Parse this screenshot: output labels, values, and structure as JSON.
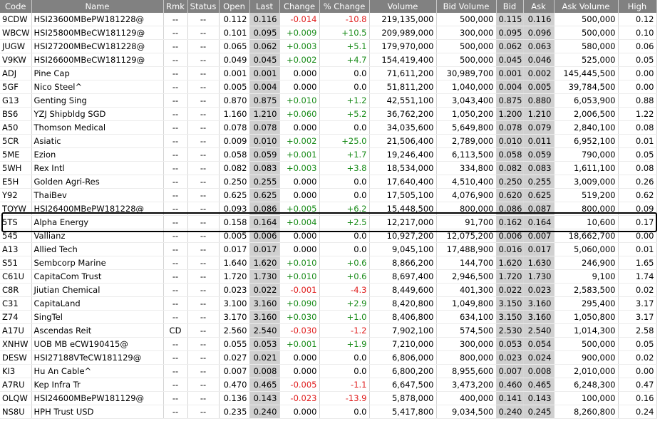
{
  "columns": [
    "Code",
    "Name",
    "Rmk",
    "Status",
    "Open",
    "Last",
    "Change",
    "% Change",
    "Volume",
    "Bid Volume",
    "Bid",
    "Ask",
    "Ask Volume",
    "High"
  ],
  "rows": [
    {
      "code": "9CDW",
      "name": "HSI23600MBePW181228@",
      "rmk": "--",
      "status": "--",
      "open": "0.112",
      "last": "0.116",
      "change": "-0.014",
      "pct": "-10.8",
      "volume": "219,135,000",
      "bid_volume": "500,000",
      "bid": "0.115",
      "ask": "0.116",
      "ask_volume": "500,000",
      "high": "0.12",
      "dir": "down"
    },
    {
      "code": "WBCW",
      "name": "HSI25800MBeCW181129@",
      "rmk": "--",
      "status": "--",
      "open": "0.101",
      "last": "0.095",
      "change": "+0.009",
      "pct": "+10.5",
      "volume": "209,989,000",
      "bid_volume": "300,000",
      "bid": "0.095",
      "ask": "0.096",
      "ask_volume": "500,000",
      "high": "0.10",
      "dir": "up"
    },
    {
      "code": "JUGW",
      "name": "HSI27200MBeCW181228@",
      "rmk": "--",
      "status": "--",
      "open": "0.065",
      "last": "0.062",
      "change": "+0.003",
      "pct": "+5.1",
      "volume": "179,970,000",
      "bid_volume": "500,000",
      "bid": "0.062",
      "ask": "0.063",
      "ask_volume": "580,000",
      "high": "0.06",
      "dir": "up"
    },
    {
      "code": "V9KW",
      "name": "HSI26600MBeCW181129@",
      "rmk": "--",
      "status": "--",
      "open": "0.049",
      "last": "0.045",
      "change": "+0.002",
      "pct": "+4.7",
      "volume": "154,419,400",
      "bid_volume": "500,000",
      "bid": "0.045",
      "ask": "0.046",
      "ask_volume": "525,000",
      "high": "0.05",
      "dir": "up"
    },
    {
      "code": "ADJ",
      "name": "Pine Cap",
      "rmk": "--",
      "status": "--",
      "open": "0.001",
      "last": "0.001",
      "change": "0.000",
      "pct": "0.0",
      "volume": "71,611,200",
      "bid_volume": "30,989,700",
      "bid": "0.001",
      "ask": "0.002",
      "ask_volume": "145,445,500",
      "high": "0.00",
      "dir": "flat"
    },
    {
      "code": "5GF",
      "name": "Nico Steel^",
      "rmk": "--",
      "status": "--",
      "open": "0.005",
      "last": "0.004",
      "change": "0.000",
      "pct": "0.0",
      "volume": "51,811,200",
      "bid_volume": "1,040,000",
      "bid": "0.004",
      "ask": "0.005",
      "ask_volume": "39,784,500",
      "high": "0.00",
      "dir": "flat"
    },
    {
      "code": "G13",
      "name": "Genting Sing",
      "rmk": "--",
      "status": "--",
      "open": "0.870",
      "last": "0.875",
      "change": "+0.010",
      "pct": "+1.2",
      "volume": "42,551,100",
      "bid_volume": "3,043,400",
      "bid": "0.875",
      "ask": "0.880",
      "ask_volume": "6,053,900",
      "high": "0.88",
      "dir": "up"
    },
    {
      "code": "BS6",
      "name": "YZJ Shipbldg SGD",
      "rmk": "--",
      "status": "--",
      "open": "1.160",
      "last": "1.210",
      "change": "+0.060",
      "pct": "+5.2",
      "volume": "36,762,200",
      "bid_volume": "1,050,200",
      "bid": "1.200",
      "ask": "1.210",
      "ask_volume": "2,006,500",
      "high": "1.22",
      "dir": "up"
    },
    {
      "code": "A50",
      "name": "Thomson Medical",
      "rmk": "--",
      "status": "--",
      "open": "0.078",
      "last": "0.078",
      "change": "0.000",
      "pct": "0.0",
      "volume": "34,035,600",
      "bid_volume": "5,649,800",
      "bid": "0.078",
      "ask": "0.079",
      "ask_volume": "2,840,100",
      "high": "0.08",
      "dir": "flat"
    },
    {
      "code": "5CR",
      "name": "Asiatic",
      "rmk": "--",
      "status": "--",
      "open": "0.009",
      "last": "0.010",
      "change": "+0.002",
      "pct": "+25.0",
      "volume": "21,506,400",
      "bid_volume": "2,789,000",
      "bid": "0.010",
      "ask": "0.011",
      "ask_volume": "6,952,100",
      "high": "0.01",
      "dir": "up"
    },
    {
      "code": "5ME",
      "name": "Ezion",
      "rmk": "--",
      "status": "--",
      "open": "0.058",
      "last": "0.059",
      "change": "+0.001",
      "pct": "+1.7",
      "volume": "19,246,400",
      "bid_volume": "6,113,500",
      "bid": "0.058",
      "ask": "0.059",
      "ask_volume": "790,000",
      "high": "0.05",
      "dir": "up"
    },
    {
      "code": "5WH",
      "name": "Rex Intl",
      "rmk": "--",
      "status": "--",
      "open": "0.082",
      "last": "0.083",
      "change": "+0.003",
      "pct": "+3.8",
      "volume": "18,534,000",
      "bid_volume": "334,800",
      "bid": "0.082",
      "ask": "0.083",
      "ask_volume": "1,611,100",
      "high": "0.08",
      "dir": "up"
    },
    {
      "code": "E5H",
      "name": "Golden Agri-Res",
      "rmk": "--",
      "status": "--",
      "open": "0.250",
      "last": "0.255",
      "change": "0.000",
      "pct": "0.0",
      "volume": "17,640,400",
      "bid_volume": "4,510,400",
      "bid": "0.250",
      "ask": "0.255",
      "ask_volume": "3,009,000",
      "high": "0.26",
      "dir": "flat"
    },
    {
      "code": "Y92",
      "name": "ThaiBev",
      "rmk": "--",
      "status": "--",
      "open": "0.625",
      "last": "0.625",
      "change": "0.000",
      "pct": "0.0",
      "volume": "17,505,100",
      "bid_volume": "4,076,900",
      "bid": "0.620",
      "ask": "0.625",
      "ask_volume": "519,200",
      "high": "0.62",
      "dir": "flat"
    },
    {
      "code": "TOYW",
      "name": "HSI26400MBePW181228@",
      "rmk": "--",
      "status": "--",
      "open": "0.093",
      "last": "0.086",
      "change": "+0.005",
      "pct": "+6.2",
      "volume": "15,448,500",
      "bid_volume": "800,000",
      "bid": "0.086",
      "ask": "0.087",
      "ask_volume": "800,000",
      "high": "0.09",
      "dir": "up"
    },
    {
      "code": "5TS",
      "name": "Alpha Energy",
      "rmk": "--",
      "status": "--",
      "open": "0.158",
      "last": "0.164",
      "change": "+0.004",
      "pct": "+2.5",
      "volume": "12,217,000",
      "bid_volume": "91,700",
      "bid": "0.162",
      "ask": "0.164",
      "ask_volume": "10,600",
      "high": "0.17",
      "dir": "up"
    },
    {
      "code": "545",
      "name": "Vallianz",
      "rmk": "--",
      "status": "--",
      "open": "0.005",
      "last": "0.006",
      "change": "0.000",
      "pct": "0.0",
      "volume": "10,927,200",
      "bid_volume": "12,075,200",
      "bid": "0.006",
      "ask": "0.007",
      "ask_volume": "18,662,700",
      "high": "0.00",
      "dir": "flat"
    },
    {
      "code": "A13",
      "name": "Allied Tech",
      "rmk": "--",
      "status": "--",
      "open": "0.017",
      "last": "0.017",
      "change": "0.000",
      "pct": "0.0",
      "volume": "9,045,100",
      "bid_volume": "17,488,900",
      "bid": "0.016",
      "ask": "0.017",
      "ask_volume": "5,060,000",
      "high": "0.01",
      "dir": "flat"
    },
    {
      "code": "S51",
      "name": "Sembcorp Marine",
      "rmk": "--",
      "status": "--",
      "open": "1.640",
      "last": "1.620",
      "change": "+0.010",
      "pct": "+0.6",
      "volume": "8,866,200",
      "bid_volume": "144,700",
      "bid": "1.620",
      "ask": "1.630",
      "ask_volume": "246,900",
      "high": "1.65",
      "dir": "up"
    },
    {
      "code": "C61U",
      "name": "CapitaCom Trust",
      "rmk": "--",
      "status": "--",
      "open": "1.720",
      "last": "1.730",
      "change": "+0.010",
      "pct": "+0.6",
      "volume": "8,697,400",
      "bid_volume": "2,946,500",
      "bid": "1.720",
      "ask": "1.730",
      "ask_volume": "9,100",
      "high": "1.74",
      "dir": "up"
    },
    {
      "code": "C8R",
      "name": "Jiutian Chemical",
      "rmk": "--",
      "status": "--",
      "open": "0.023",
      "last": "0.022",
      "change": "-0.001",
      "pct": "-4.3",
      "volume": "8,449,600",
      "bid_volume": "401,300",
      "bid": "0.022",
      "ask": "0.023",
      "ask_volume": "2,583,500",
      "high": "0.02",
      "dir": "down"
    },
    {
      "code": "C31",
      "name": "CapitaLand",
      "rmk": "--",
      "status": "--",
      "open": "3.100",
      "last": "3.160",
      "change": "+0.090",
      "pct": "+2.9",
      "volume": "8,420,800",
      "bid_volume": "1,049,800",
      "bid": "3.150",
      "ask": "3.160",
      "ask_volume": "295,400",
      "high": "3.17",
      "dir": "up"
    },
    {
      "code": "Z74",
      "name": "SingTel",
      "rmk": "--",
      "status": "--",
      "open": "3.170",
      "last": "3.160",
      "change": "+0.030",
      "pct": "+1.0",
      "volume": "8,406,800",
      "bid_volume": "634,100",
      "bid": "3.150",
      "ask": "3.160",
      "ask_volume": "1,050,800",
      "high": "3.17",
      "dir": "up"
    },
    {
      "code": "A17U",
      "name": "Ascendas Reit",
      "rmk": "CD",
      "status": "--",
      "open": "2.560",
      "last": "2.540",
      "change": "-0.030",
      "pct": "-1.2",
      "volume": "7,902,100",
      "bid_volume": "574,500",
      "bid": "2.530",
      "ask": "2.540",
      "ask_volume": "1,014,300",
      "high": "2.58",
      "dir": "down"
    },
    {
      "code": "XNHW",
      "name": "UOB MB eCW190415@",
      "rmk": "--",
      "status": "--",
      "open": "0.055",
      "last": "0.053",
      "change": "+0.001",
      "pct": "+1.9",
      "volume": "7,210,000",
      "bid_volume": "300,000",
      "bid": "0.053",
      "ask": "0.054",
      "ask_volume": "500,000",
      "high": "0.05",
      "dir": "up"
    },
    {
      "code": "DESW",
      "name": "HSI27188VTeCW181129@",
      "rmk": "--",
      "status": "--",
      "open": "0.027",
      "last": "0.021",
      "change": "0.000",
      "pct": "0.0",
      "volume": "6,806,000",
      "bid_volume": "800,000",
      "bid": "0.023",
      "ask": "0.024",
      "ask_volume": "900,000",
      "high": "0.02",
      "dir": "flat"
    },
    {
      "code": "KI3",
      "name": "Hu An Cable^",
      "rmk": "--",
      "status": "--",
      "open": "0.007",
      "last": "0.008",
      "change": "0.000",
      "pct": "0.0",
      "volume": "6,800,200",
      "bid_volume": "8,955,600",
      "bid": "0.007",
      "ask": "0.008",
      "ask_volume": "2,010,000",
      "high": "0.00",
      "dir": "flat"
    },
    {
      "code": "A7RU",
      "name": "Kep Infra Tr",
      "rmk": "--",
      "status": "--",
      "open": "0.470",
      "last": "0.465",
      "change": "-0.005",
      "pct": "-1.1",
      "volume": "6,647,500",
      "bid_volume": "3,473,200",
      "bid": "0.460",
      "ask": "0.465",
      "ask_volume": "6,248,300",
      "high": "0.47",
      "dir": "down"
    },
    {
      "code": "OLQW",
      "name": "HSI24600MBePW181129@",
      "rmk": "--",
      "status": "--",
      "open": "0.136",
      "last": "0.143",
      "change": "-0.023",
      "pct": "-13.9",
      "volume": "5,878,000",
      "bid_volume": "400,000",
      "bid": "0.141",
      "ask": "0.143",
      "ask_volume": "100,000",
      "high": "0.16",
      "dir": "down"
    },
    {
      "code": "NS8U",
      "name": "HPH Trust USD",
      "rmk": "--",
      "status": "--",
      "open": "0.235",
      "last": "0.240",
      "change": "0.000",
      "pct": "0.0",
      "volume": "5,417,800",
      "bid_volume": "9,034,500",
      "bid": "0.240",
      "ask": "0.245",
      "ask_volume": "8,260,800",
      "high": "0.24",
      "dir": "flat"
    }
  ],
  "colors": {
    "header_bg": "#818181",
    "shaded_cell": "#d0d0d0",
    "up": "#1a8c1a",
    "down": "#e02020"
  }
}
